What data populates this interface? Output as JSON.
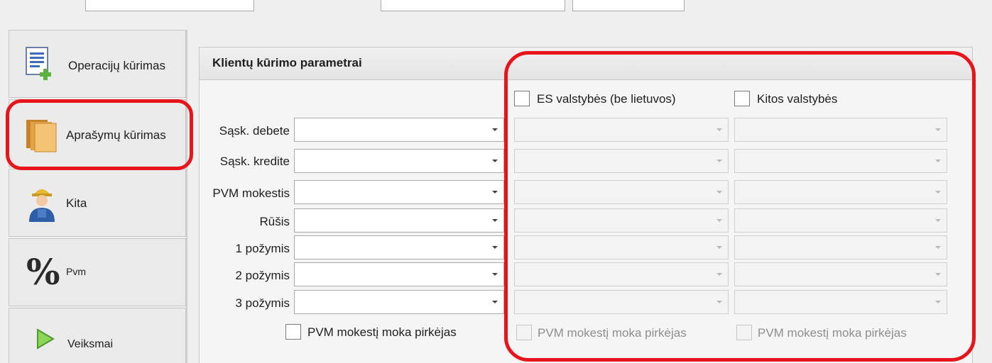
{
  "nav": {
    "items": [
      {
        "label": "Operacijų kūrimas",
        "icon": "document-add-icon"
      },
      {
        "label": "Aprašymų kūrimas",
        "icon": "folders-icon"
      },
      {
        "label": "Kita",
        "icon": "worker-icon"
      },
      {
        "label": "Pvm",
        "icon": "percent-icon"
      },
      {
        "label": "Veiksmai",
        "icon": "play-icon"
      }
    ]
  },
  "panel": {
    "title": "Klientų kūrimo parametrai",
    "columns": {
      "es": "ES valstybės (be lietuvos)",
      "other": "Kitos valstybės"
    },
    "rows": [
      {
        "label": "Sąsk. debete"
      },
      {
        "label": "Sąsk. kredite"
      },
      {
        "label": "PVM mokestis"
      },
      {
        "label": "Rūšis"
      },
      {
        "label": "1 požymis"
      },
      {
        "label": "2 požymis"
      },
      {
        "label": "3 požymis"
      }
    ],
    "buyer_pays_vat_label": "PVM mokestį moka pirkėjas"
  },
  "colors": {
    "annotation": "#e8141c"
  }
}
